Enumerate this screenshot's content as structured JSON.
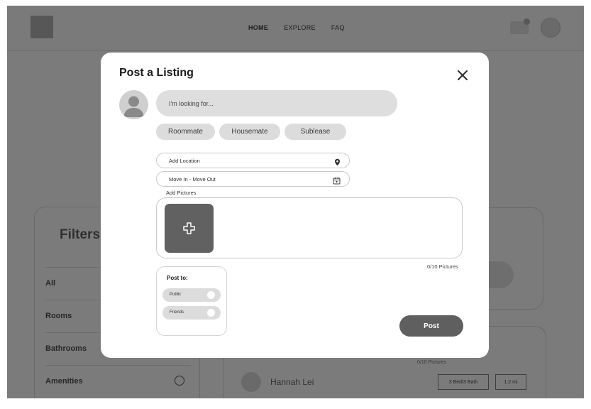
{
  "nav": {
    "links": [
      "HOME",
      "EXPLORE",
      "FAQ"
    ],
    "active": "HOME"
  },
  "background": {
    "filters": {
      "title": "Filters",
      "items": [
        "All",
        "Rooms",
        "Bathrooms",
        "Amenities"
      ]
    },
    "listing": {
      "pictures_count": "0/10 Pictures",
      "user_name": "Hannah Lei",
      "tags": [
        "3 Bed/3 Bath",
        "1.2 mi"
      ]
    }
  },
  "modal": {
    "title": "Post a Listing",
    "search_placeholder": "I'm looking for...",
    "categories": [
      "Roommate",
      "Housemate",
      "Sublease"
    ],
    "location_placeholder": "Add Location",
    "dates_placeholder": "Move In - Move Out",
    "add_pictures_label": "Add Pictures",
    "pictures_count": "0/10 Pictures",
    "post_to": {
      "label": "Post to:",
      "options": [
        "Public",
        "Friends"
      ]
    },
    "post_button": "Post"
  },
  "icons": {
    "close": "close-icon",
    "location": "location-pin-icon",
    "calendar": "calendar-icon",
    "add": "plus-icon",
    "avatar": "user-avatar-icon"
  },
  "colors": {
    "overlay": "#7b7b7b",
    "modal": "#ffffff",
    "chip": "#dcdcdc",
    "primary_button": "#5f5f5f"
  }
}
